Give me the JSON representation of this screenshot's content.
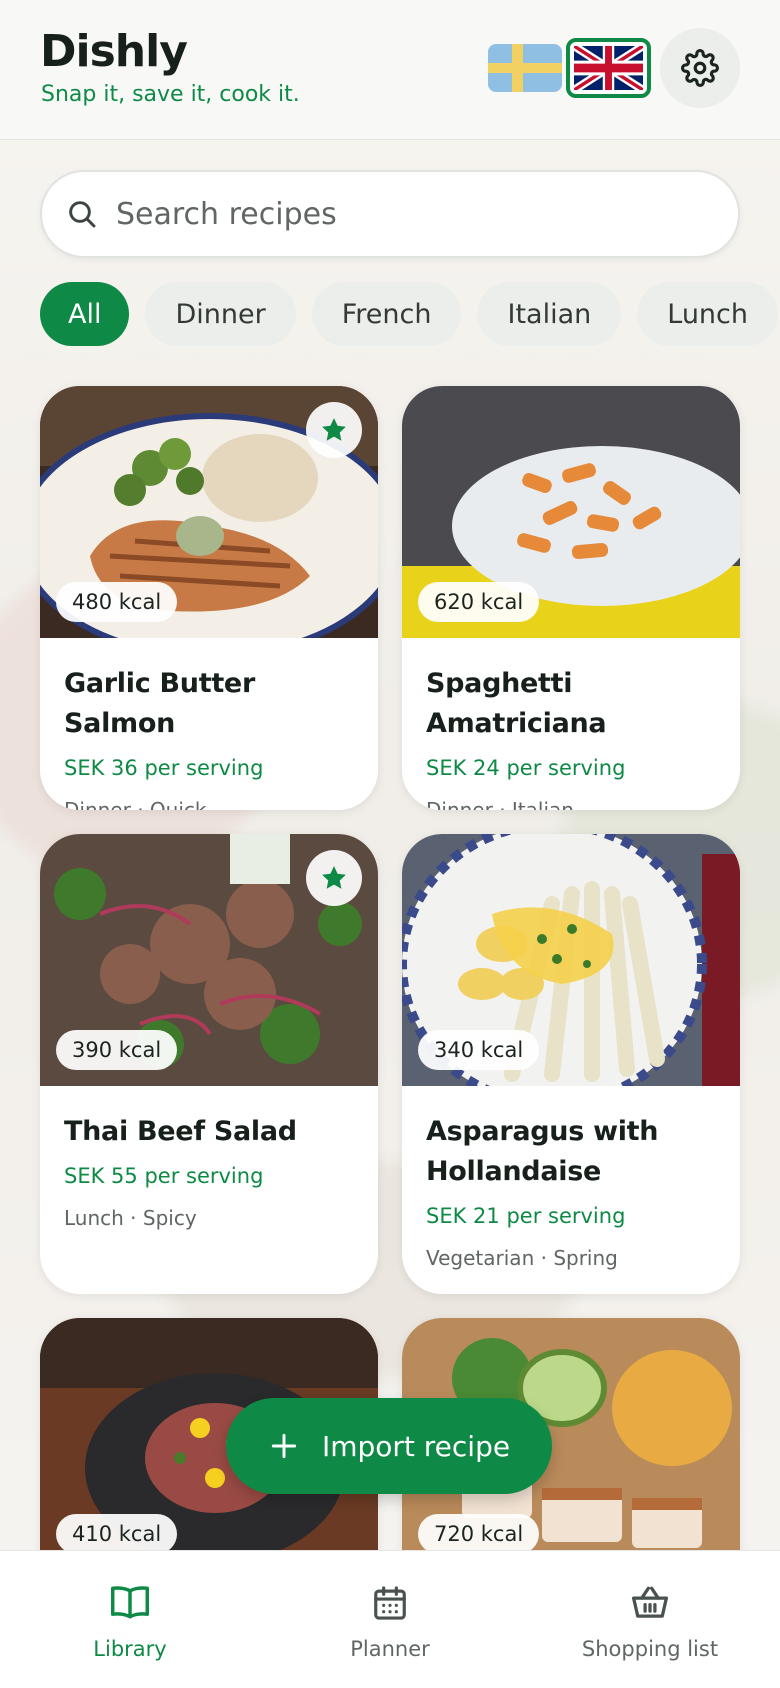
{
  "header": {
    "title": "Dishly",
    "tagline": "Snap it, save it, cook it.",
    "languages": [
      {
        "code": "sv",
        "icon": "flag-sweden-icon",
        "active": false
      },
      {
        "code": "en",
        "icon": "flag-uk-icon",
        "active": true
      }
    ],
    "settings_icon": "gear-icon"
  },
  "search": {
    "placeholder": "Search recipes",
    "value": "",
    "icon": "search-icon"
  },
  "filters": {
    "chips": [
      "All",
      "Dinner",
      "French",
      "Italian",
      "Lunch"
    ],
    "active": "All"
  },
  "recipes": [
    {
      "title": "Garlic Butter Salmon",
      "price": "SEK 36 per serving",
      "meta": "Dinner · Quick",
      "kcal": "480 kcal",
      "favorite": true
    },
    {
      "title": "Spaghetti Amatriciana",
      "price": "SEK 24 per serving",
      "meta": "Dinner · Italian",
      "kcal": "620 kcal",
      "favorite": false
    },
    {
      "title": "Thai Beef Salad",
      "price": "SEK 55 per serving",
      "meta": "Lunch · Spicy",
      "kcal": "390 kcal",
      "favorite": true
    },
    {
      "title": "Asparagus with Hollandaise",
      "price": "SEK 21 per serving",
      "meta": "Vegetarian · Spring",
      "kcal": "340 kcal",
      "favorite": false
    },
    {
      "kcal": "410 kcal",
      "favorite": false
    },
    {
      "kcal": "720 kcal",
      "favorite": false
    }
  ],
  "fab": {
    "label": "Import recipe",
    "icon": "plus-icon"
  },
  "nav": {
    "items": [
      {
        "label": "Library",
        "icon": "book-icon",
        "active": true
      },
      {
        "label": "Planner",
        "icon": "calendar-icon",
        "active": false
      },
      {
        "label": "Shopping list",
        "icon": "basket-icon",
        "active": false
      }
    ]
  },
  "colors": {
    "accent": "#0e8a46",
    "chip_bg": "#eceeec",
    "text": "#17201b",
    "muted": "#5f6663"
  }
}
